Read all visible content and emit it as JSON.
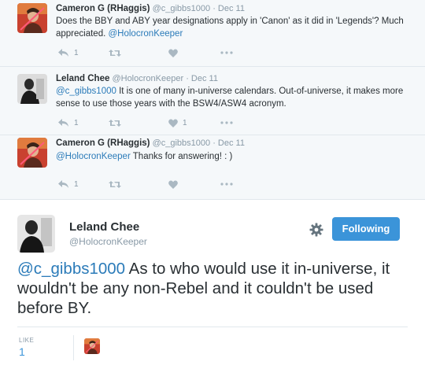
{
  "thread": [
    {
      "name": "Cameron G (RHaggis)",
      "handle": "@c_gibbs1000",
      "dot": "·",
      "date": "Dec 11",
      "text_plain": "Does the BBY and ABY year designations apply in 'Canon' as it did in 'Legends'? Much appreciated. ",
      "text_mention": "@HolocronKeeper",
      "reply_count": "1",
      "like_count": "",
      "avatar": "red-orange-avatar"
    },
    {
      "name": "Leland Chee",
      "handle": "@HolocronKeeper",
      "dot": "·",
      "date": "Dec 11",
      "text_mention": "@c_gibbs1000",
      "text_plain": " It is one of many in-universe calendars. Out-of-universe, it makes more sense to use those years with the BSW4/ASW4 acronym.",
      "reply_count": "1",
      "like_count": "1",
      "avatar": "dark-silhouette-avatar"
    },
    {
      "name": "Cameron G (RHaggis)",
      "handle": "@c_gibbs1000",
      "dot": "·",
      "date": "Dec 11",
      "text_mention": "@HolocronKeeper",
      "text_plain": " Thanks for answering! : )",
      "reply_count": "1",
      "like_count": "",
      "avatar": "red-orange-avatar"
    }
  ],
  "icons": {
    "reply": "reply-icon",
    "retweet": "retweet-icon",
    "like": "heart-icon",
    "more": "more-icon",
    "settings": "gear-icon"
  },
  "main": {
    "name": "Leland Chee",
    "handle": "@HolocronKeeper",
    "follow_label": "Following",
    "text_mention": "@c_gibbs1000",
    "text_plain": " As to who would use it in-universe, it wouldn't be any non-Rebel and it couldn't be used before BY.",
    "like_label": "LIKE",
    "like_count": "1"
  },
  "colors": {
    "accent": "#3b94d9",
    "mention": "#2b7bb9",
    "muted": "#8899a6",
    "thread_bg": "#f5f8fa"
  }
}
